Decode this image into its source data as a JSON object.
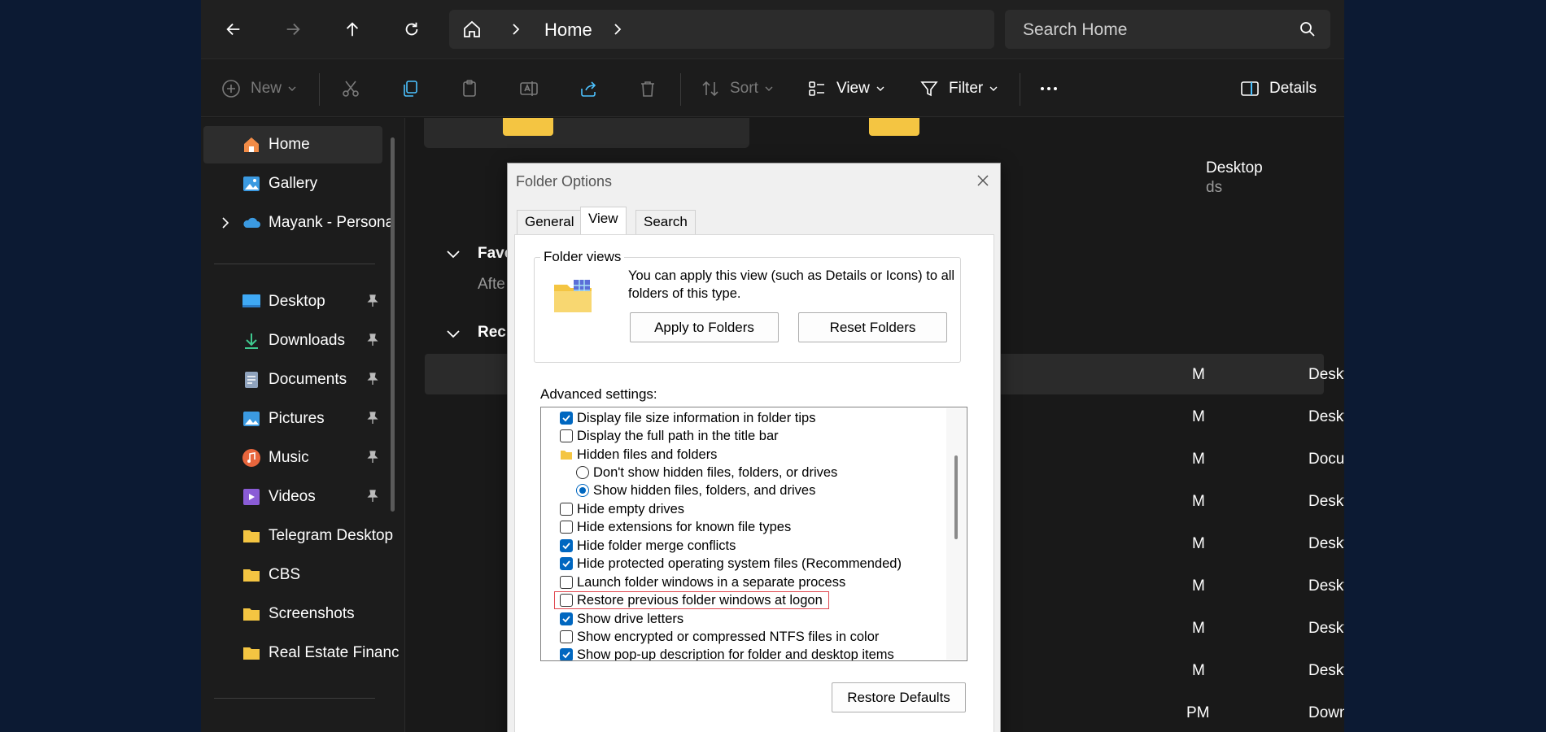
{
  "titlebar": {
    "crumb": "Home",
    "search_placeholder": "Search Home"
  },
  "toolbar": {
    "new_label": "New",
    "sort_label": "Sort",
    "view_label": "View",
    "filter_label": "Filter",
    "details_label": "Details"
  },
  "sidebar": {
    "top": [
      {
        "label": "Home",
        "icon": "home-icon"
      },
      {
        "label": "Gallery",
        "icon": "gallery-icon"
      },
      {
        "label": "Mayank - Persona",
        "icon": "onedrive-icon"
      }
    ],
    "pinned": [
      {
        "label": "Desktop",
        "icon": "desktop-icon"
      },
      {
        "label": "Downloads",
        "icon": "downloads-icon"
      },
      {
        "label": "Documents",
        "icon": "documents-icon"
      },
      {
        "label": "Pictures",
        "icon": "pictures-icon"
      },
      {
        "label": "Music",
        "icon": "music-icon"
      },
      {
        "label": "Videos",
        "icon": "videos-icon"
      }
    ],
    "folders": [
      {
        "label": "Telegram Desktop"
      },
      {
        "label": "CBS"
      },
      {
        "label": "Screenshots"
      },
      {
        "label": "Real Estate Financ"
      }
    ]
  },
  "content": {
    "card_right_title_partial": "Desktop",
    "card_right_sub_partial": "ds",
    "favorites_partial": "Favo",
    "favorites_sub_partial": "Afte",
    "recent_partial": "Rec",
    "row_times": [
      "M",
      "M",
      "M",
      "M",
      "M",
      "M",
      "M",
      "M",
      "PM"
    ],
    "row_locations": [
      "Desktop",
      "Desktop",
      "Documents",
      "Desktop",
      "Desktop",
      "Desktop",
      "Desktop",
      "Desktop",
      "Downloads"
    ]
  },
  "dialog": {
    "title": "Folder Options",
    "tabs": [
      "General",
      "View",
      "Search"
    ],
    "folder_views_title": "Folder views",
    "folder_views_text": "You can apply this view (such as Details or Icons) to all folders of this type.",
    "apply_button": "Apply to Folders",
    "reset_button": "Reset Folders",
    "advanced_label": "Advanced settings:",
    "restore_defaults": "Restore Defaults",
    "settings": [
      {
        "label": "Display file size information in folder tips",
        "kind": "checkbox",
        "checked": true
      },
      {
        "label": "Display the full path in the title bar",
        "kind": "checkbox",
        "checked": false
      },
      {
        "label": "Hidden files and folders",
        "kind": "folder",
        "checked": false
      },
      {
        "label": "Don't show hidden files, folders, or drives",
        "kind": "radio",
        "checked": false
      },
      {
        "label": "Show hidden files, folders, and drives",
        "kind": "radio",
        "checked": true
      },
      {
        "label": "Hide empty drives",
        "kind": "checkbox",
        "checked": false
      },
      {
        "label": "Hide extensions for known file types",
        "kind": "checkbox",
        "checked": false
      },
      {
        "label": "Hide folder merge conflicts",
        "kind": "checkbox",
        "checked": true
      },
      {
        "label": "Hide protected operating system files (Recommended)",
        "kind": "checkbox",
        "checked": true
      },
      {
        "label": "Launch folder windows in a separate process",
        "kind": "checkbox",
        "checked": false
      },
      {
        "label": "Restore previous folder windows at logon",
        "kind": "checkbox",
        "checked": false
      },
      {
        "label": "Show drive letters",
        "kind": "checkbox",
        "checked": true
      },
      {
        "label": "Show encrypted or compressed NTFS files in color",
        "kind": "checkbox",
        "checked": false
      },
      {
        "label": "Show pop-up description for folder and desktop items",
        "kind": "checkbox",
        "checked": true
      }
    ],
    "accent": "#0067c0",
    "highlight": "#e0474f"
  }
}
